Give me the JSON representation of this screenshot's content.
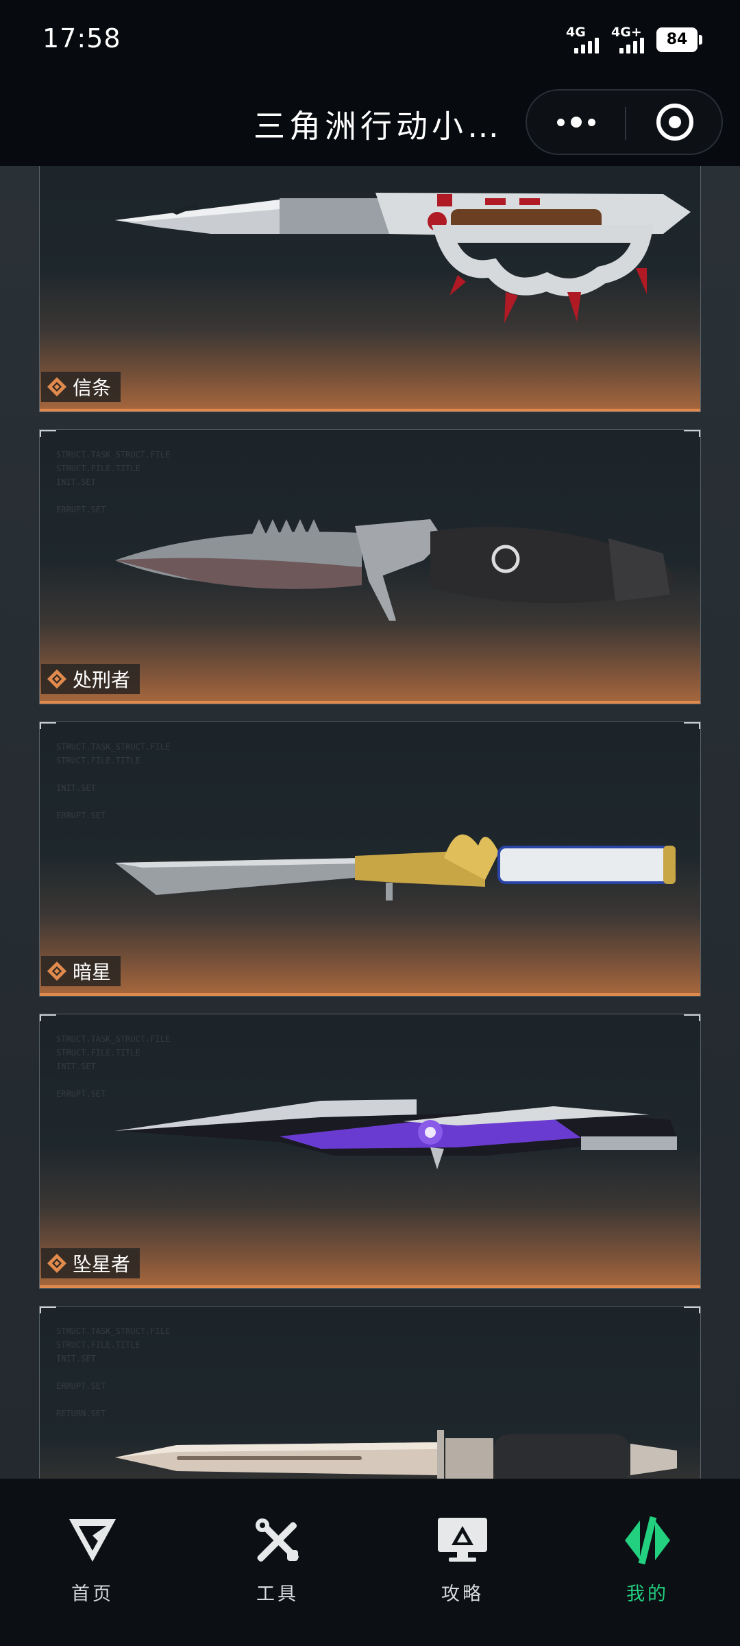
{
  "status_bar": {
    "time": "17:58",
    "signal1": "4G",
    "signal2": "4G+",
    "battery": "84"
  },
  "header": {
    "title": "三角洲行动小…",
    "more_icon": "more-dots-icon",
    "close_icon": "target-close-icon"
  },
  "cards": [
    {
      "name": "信条",
      "weapon": "knuckle-knife"
    },
    {
      "name": "处刑者",
      "weapon": "serrated-knife"
    },
    {
      "name": "暗星",
      "weapon": "pearl-golden-knife"
    },
    {
      "name": "坠星者",
      "weapon": "violet-blade"
    },
    {
      "name": "",
      "weapon": "bayonet"
    }
  ],
  "nav": {
    "items": [
      {
        "label": "首页",
        "icon": "home-logo-icon",
        "active": false
      },
      {
        "label": "工具",
        "icon": "tools-icon",
        "active": false
      },
      {
        "label": "攻略",
        "icon": "guide-monitor-icon",
        "active": false
      },
      {
        "label": "我的",
        "icon": "mine-logo-icon",
        "active": true
      }
    ]
  },
  "colors": {
    "accent_orange": "#e08a4d",
    "active_green": "#22d07f",
    "background": "#06090c"
  }
}
